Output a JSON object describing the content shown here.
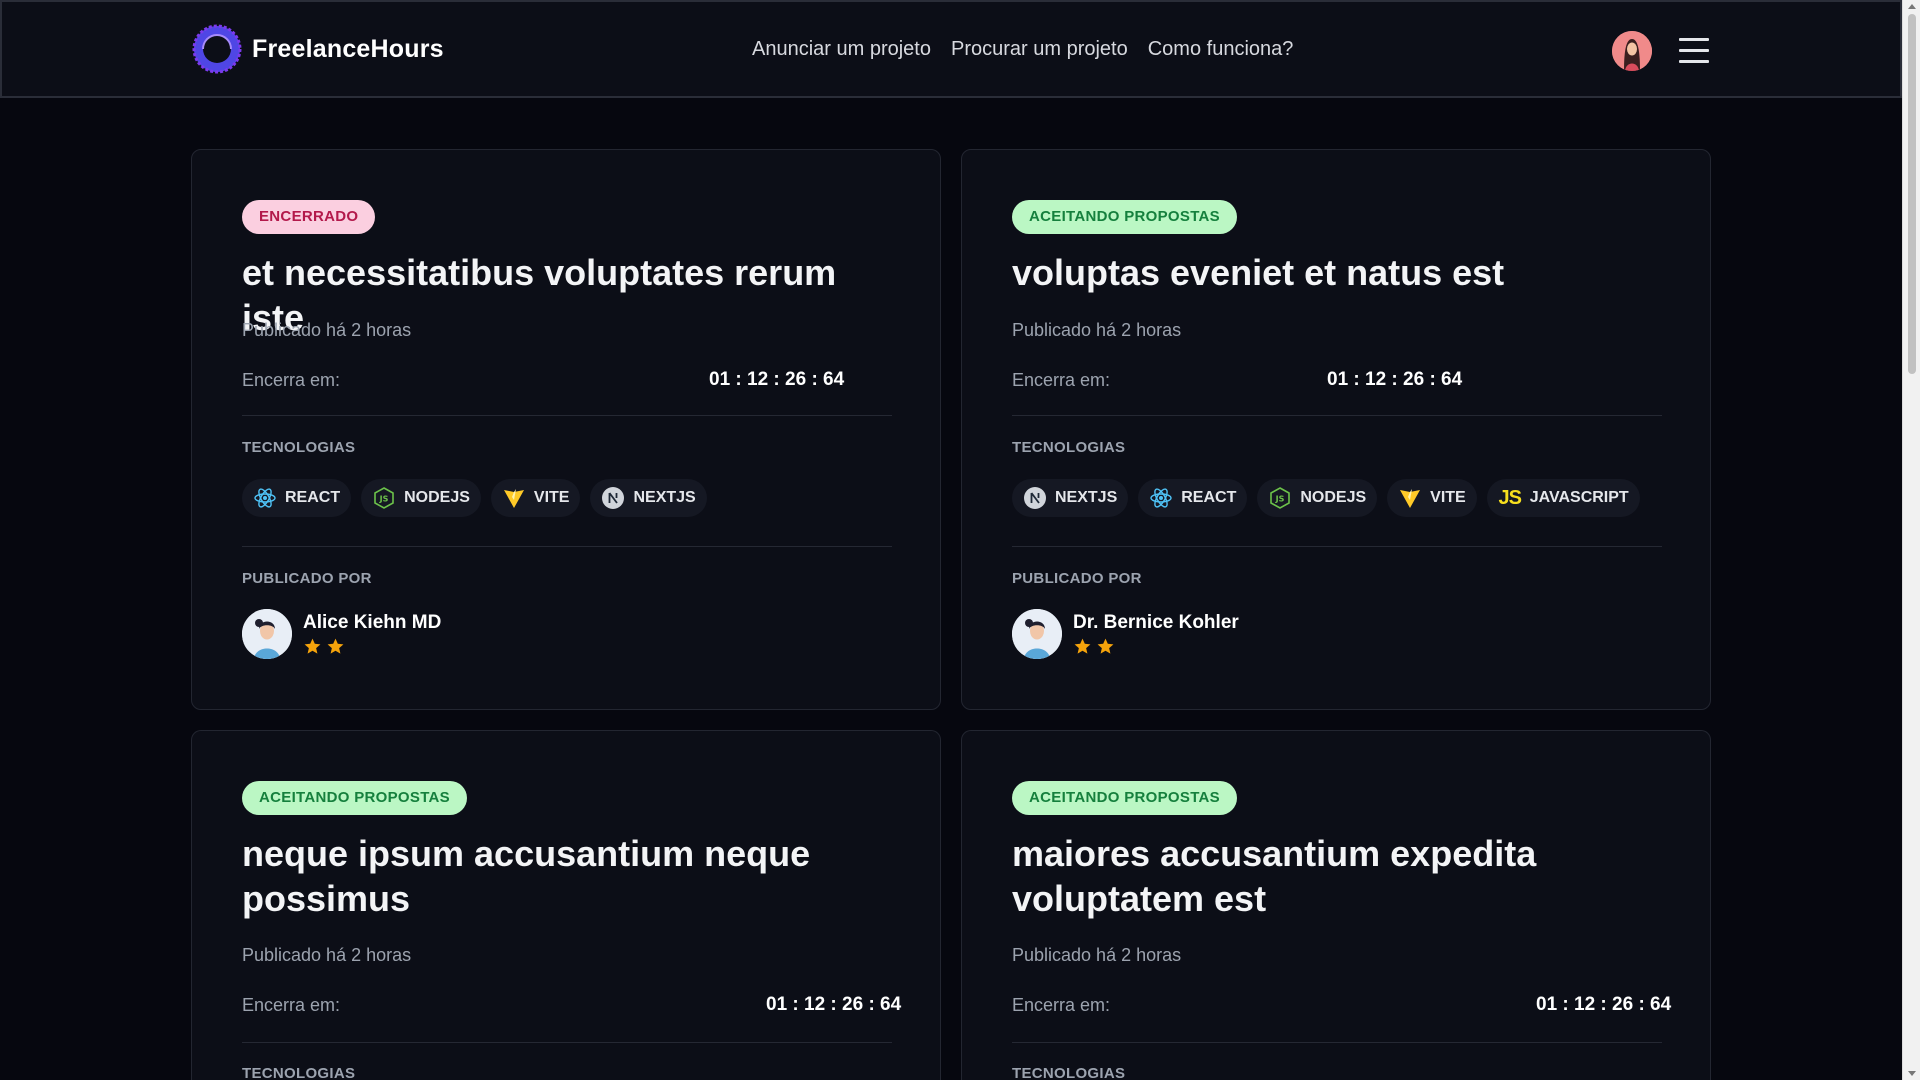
{
  "header": {
    "brand": "FreelanceHours",
    "nav": [
      "Anunciar um projeto",
      "Procurar um projeto",
      "Como funciona?"
    ]
  },
  "labels": {
    "published": "Publicado há 2 horas",
    "ends": "Encerra em:",
    "technologies": "TECNOLOGIAS",
    "published_by": "PUBLICADO POR"
  },
  "colors": {
    "background": "#06070f",
    "card": "#0c0e17",
    "closed_badge": "#fbcfe0",
    "open_badge": "#bbf7c4",
    "star": "#f5a30b"
  },
  "cards": [
    {
      "status": "ENCERRADO",
      "title": "et necessitatibus voluptates rerum iste",
      "time": "01 : 12 : 26 : 64",
      "techs": [
        "REACT",
        "NODEJS",
        "VITE",
        "NEXTJS"
      ],
      "author": "Alice Kiehn MD",
      "rating": 2
    },
    {
      "status": "ACEITANDO PROPOSTAS",
      "title": "voluptas eveniet et natus est",
      "time": "01 : 12 : 26 : 64",
      "techs": [
        "NEXTJS",
        "REACT",
        "NODEJS",
        "VITE",
        "JAVASCRIPT"
      ],
      "author": "Dr. Bernice Kohler",
      "rating": 2
    },
    {
      "status": "ACEITANDO PROPOSTAS",
      "title": "neque ipsum accusantium neque possimus",
      "time": "01 : 12 : 26 : 64"
    },
    {
      "status": "ACEITANDO PROPOSTAS",
      "title": "maiores accusantium expedita voluptatem est",
      "time": "01 : 12 : 26 : 64"
    }
  ]
}
